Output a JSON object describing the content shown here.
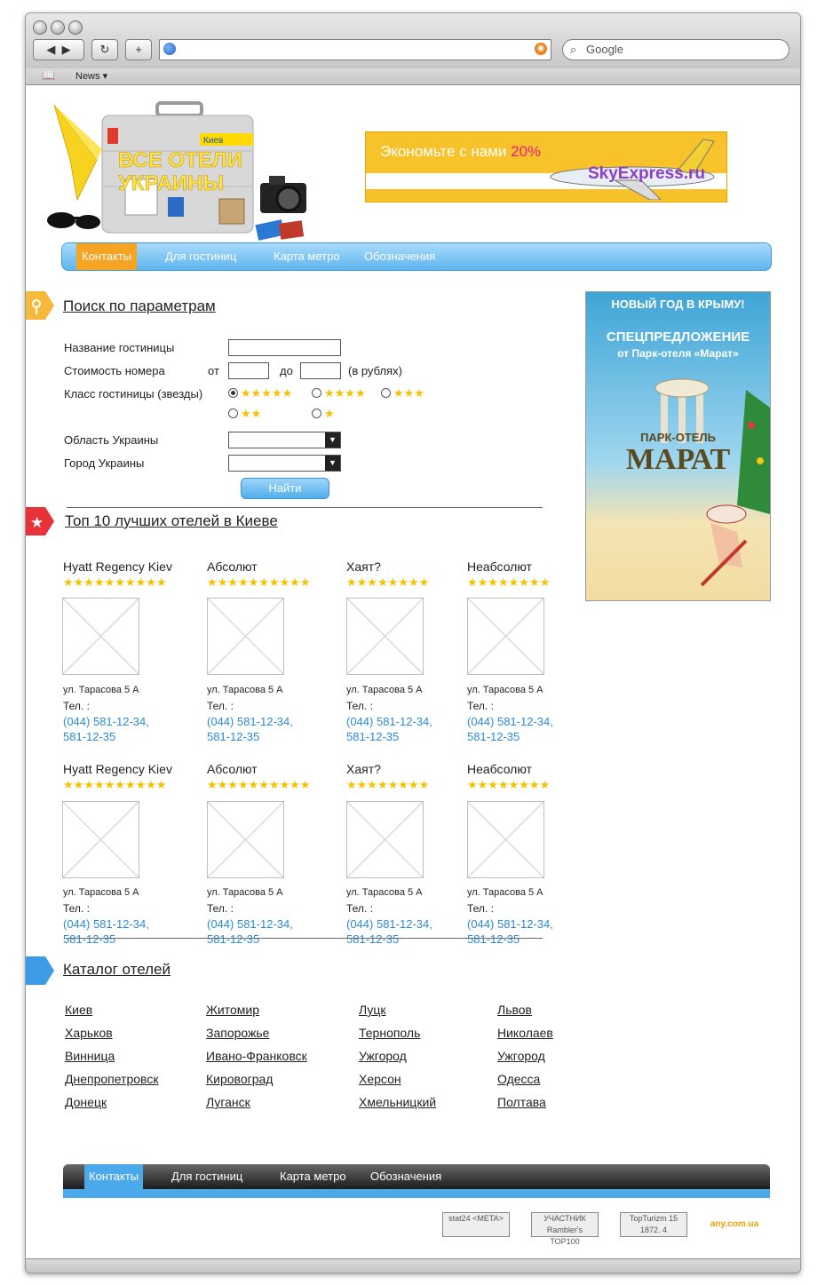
{
  "browser": {
    "search_placeholder": "Google",
    "bookmarks_item": "News"
  },
  "header": {
    "logo_line1": "ВСЕ ОТЕЛИ",
    "logo_line2": "УКРАИНЫ",
    "logo_city": "Киев",
    "banner_text": "Экономьте с нами",
    "banner_percent": "20%",
    "banner_brand": "SkyExpress.ru"
  },
  "menu": {
    "items": [
      "Контакты",
      "Для гостиниц",
      "Карта метро",
      "Обозначения"
    ]
  },
  "search": {
    "title": "Поиск по параметрам",
    "hotel_name_label": "Название гостиницы",
    "price_label": "Стоимость номера",
    "from": "от",
    "to": "до",
    "currency": "(в рублях)",
    "class_label": "Класс гостиницы (звезды)",
    "star_options": [
      "★★★★★",
      "★★★★",
      "★★★",
      "★★",
      "★"
    ],
    "region_label": "Область Украины",
    "city_label": "Город Украины",
    "button": "Найти"
  },
  "top": {
    "title": "Топ 10 лучших отелей в Киеве",
    "hotels": [
      {
        "name": "Hyatt Regency Kiev",
        "stars": "★★★★★★★★★★",
        "address": "ул. Тарасова 5 А",
        "tel_label": "Тел. :",
        "phone1": "(044) 581-12-34,",
        "phone2": "581-12-35"
      },
      {
        "name": "Абсолют",
        "stars": "★★★★★★★★★★",
        "address": "ул. Тарасова 5 А",
        "tel_label": "Тел. :",
        "phone1": "(044) 581-12-34,",
        "phone2": "581-12-35"
      },
      {
        "name": "Хаят?",
        "stars": "★★★★★★★★",
        "address": "ул. Тарасова 5 А",
        "tel_label": "Тел. :",
        "phone1": "(044) 581-12-34,",
        "phone2": "581-12-35"
      },
      {
        "name": "Неабсолют",
        "stars": "★★★★★★★★",
        "address": "ул. Тарасова 5 А",
        "tel_label": "Тел. :",
        "phone1": "(044) 581-12-34,",
        "phone2": "581-12-35"
      },
      {
        "name": "Hyatt Regency Kiev",
        "stars": "★★★★★★★★★★",
        "address": "ул. Тарасова 5 А",
        "tel_label": "Тел. :",
        "phone1": "(044) 581-12-34,",
        "phone2": "581-12-35"
      },
      {
        "name": "Абсолют",
        "stars": "★★★★★★★★★★",
        "address": "ул. Тарасова 5 А",
        "tel_label": "Тел. :",
        "phone1": "(044) 581-12-34,",
        "phone2": "581-12-35"
      },
      {
        "name": "Хаят?",
        "stars": "★★★★★★★★",
        "address": "ул. Тарасова 5 А",
        "tel_label": "Тел. :",
        "phone1": "(044) 581-12-34,",
        "phone2": "581-12-35"
      },
      {
        "name": "Неабсолют",
        "stars": "★★★★★★★★",
        "address": "ул. Тарасова 5 А",
        "tel_label": "Тел. :",
        "phone1": "(044) 581-12-34,",
        "phone2": "581-12-35"
      }
    ]
  },
  "catalog": {
    "title": "Каталог отелей",
    "columns": [
      [
        "Киев",
        "Харьков",
        "Винница",
        "Днепропетровск",
        "Донецк"
      ],
      [
        "Житомир",
        "Запорожье",
        "Ивано-Франковск",
        "Кировоград",
        "Луганск"
      ],
      [
        "Луцк",
        "Тернополь",
        "Ужгород",
        "Херсон",
        "Хмельницкий"
      ],
      [
        "Львов",
        "Николаев",
        "Ужгород",
        "Одесса",
        "Полтава"
      ]
    ]
  },
  "side_ad": {
    "line1": "НОВЫЙ ГОД В КРЫМУ!",
    "line2": "СПЕЦПРЕДЛОЖЕНИЕ",
    "line3": "от Парк-отеля «Марат»",
    "line4": "ПАРК-ОТЕЛЬ",
    "line5": "МАРАТ"
  },
  "footer": {
    "items": [
      "Контакты",
      "Для гостиниц",
      "Карта метро",
      "Обозначения"
    ],
    "counters": [
      "stat24 <META>",
      "УЧАСТНИК Rambler's TOP100",
      "TopTurizm 15 1872. 4",
      "any.com.ua"
    ]
  },
  "colors": {
    "menu_blue": "#5eb5ef",
    "menu_active": "#f6a423",
    "link_blue": "#2a8ad8",
    "star_yellow": "#f6c200"
  }
}
